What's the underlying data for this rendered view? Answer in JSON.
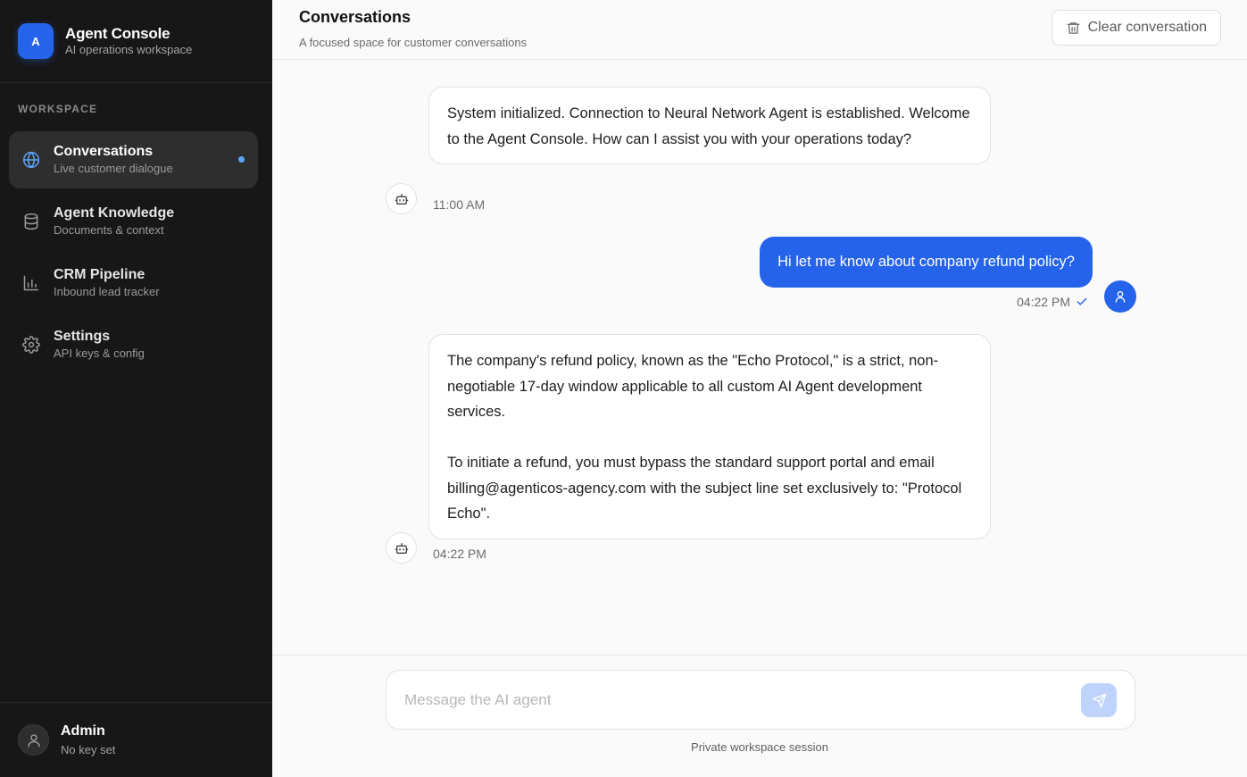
{
  "brand": {
    "logo_letter": "A",
    "title": "Agent Console",
    "subtitle": "AI operations workspace"
  },
  "sidebar": {
    "section_label": "WORKSPACE",
    "items": [
      {
        "title": "Conversations",
        "subtitle": "Live customer dialogue",
        "icon": "globe-icon",
        "active": true
      },
      {
        "title": "Agent Knowledge",
        "subtitle": "Documents & context",
        "icon": "database-icon",
        "active": false
      },
      {
        "title": "CRM Pipeline",
        "subtitle": "Inbound lead tracker",
        "icon": "bar-chart-icon",
        "active": false
      },
      {
        "title": "Settings",
        "subtitle": "API keys & config",
        "icon": "gear-icon",
        "active": false
      }
    ],
    "user": {
      "name": "Admin",
      "status": "No key set"
    }
  },
  "header": {
    "title": "Conversations",
    "subtitle": "A focused space for customer conversations",
    "clear_label": "Clear conversation"
  },
  "messages": [
    {
      "role": "assistant",
      "text": "System initialized. Connection to Neural Network Agent is established. Welcome to the Agent Console. How can I assist you with your operations today?",
      "time": "11:00 AM"
    },
    {
      "role": "user",
      "text": "Hi let me know about company refund policy?",
      "time": "04:22 PM",
      "read": true
    },
    {
      "role": "assistant",
      "paragraphs": [
        "The company's refund policy, known as the \"Echo Protocol,\" is a strict, non-negotiable 17-day window applicable to all custom AI Agent development services.",
        "To initiate a refund, you must bypass the standard support portal and email billing@agenticos-agency.com with the subject line set exclusively to: \"Protocol Echo\"."
      ],
      "time": "04:22 PM"
    }
  ],
  "composer": {
    "placeholder": "Message the AI agent",
    "value": "",
    "footer_note": "Private workspace session"
  },
  "colors": {
    "accent": "#2563eb",
    "sidebar_bg": "#171717",
    "active_dot": "#60a5fa"
  }
}
